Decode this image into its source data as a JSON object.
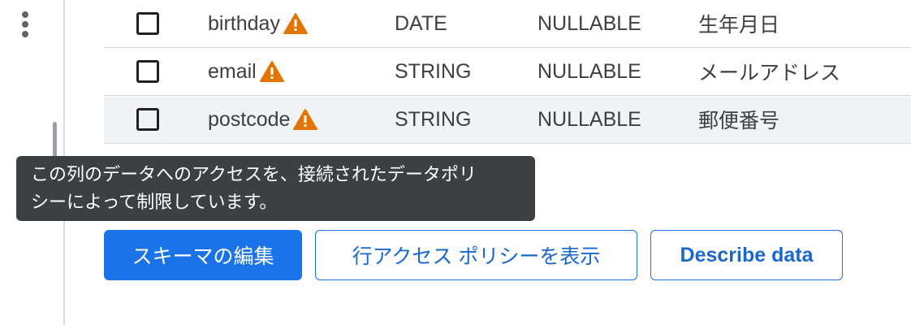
{
  "sidebar": {
    "more_icon": "more-vert-icon"
  },
  "schema_table": {
    "rows": [
      {
        "name": "birthday",
        "type": "DATE",
        "mode": "NULLABLE",
        "description": "生年月日",
        "warning_icon": "warning-triangle-icon"
      },
      {
        "name": "email",
        "type": "STRING",
        "mode": "NULLABLE",
        "description": "メールアドレス",
        "warning_icon": "warning-triangle-icon"
      },
      {
        "name": "postcode",
        "type": "STRING",
        "mode": "NULLABLE",
        "description": "郵便番号",
        "warning_icon": "warning-triangle-icon"
      }
    ]
  },
  "tooltip": {
    "line1": "この列のデータへのアクセスを、接続されたデータポリ",
    "line2": "シーによって制限しています。"
  },
  "actions": {
    "edit_schema": "スキーマの編集",
    "view_row_access_policies": "行アクセス ポリシーを表示",
    "describe_data": "Describe data"
  },
  "colors": {
    "primary": "#1a73e8",
    "warning": "#e37400",
    "tooltip_bg": "#3c4043"
  }
}
